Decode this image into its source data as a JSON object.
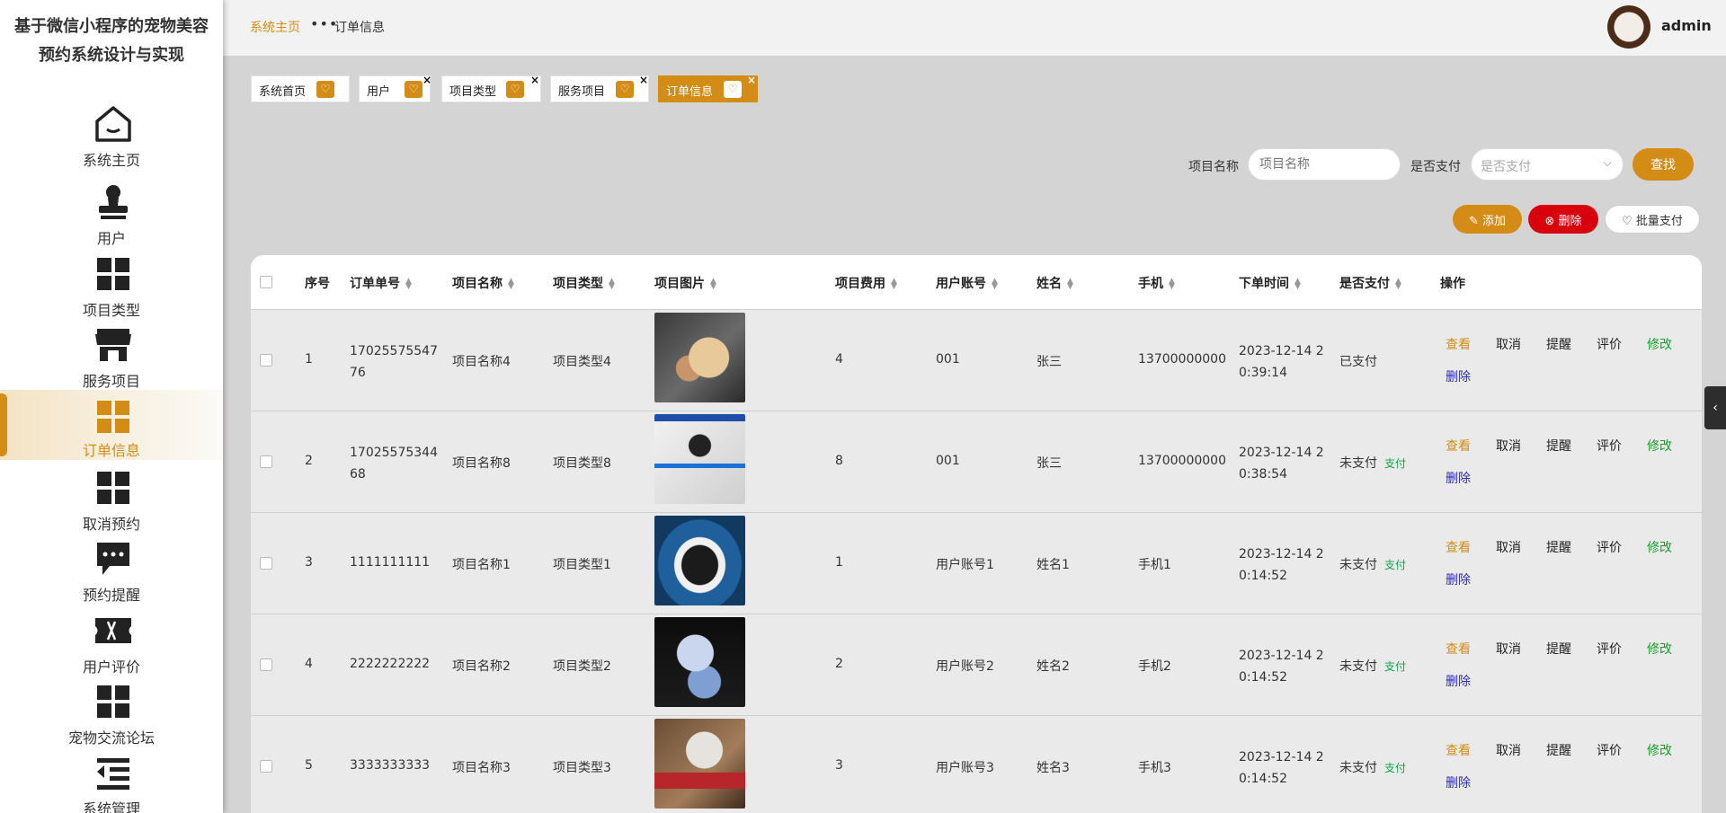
{
  "app_title": "基于微信小程序的宠物美容预约系统设计与实现",
  "sidebar": {
    "items": [
      {
        "label": "系统主页",
        "icon": "home-icon"
      },
      {
        "label": "用户",
        "icon": "user-icon"
      },
      {
        "label": "项目类型",
        "icon": "grid-icon"
      },
      {
        "label": "服务项目",
        "icon": "shop-icon"
      },
      {
        "label": "订单信息",
        "icon": "grid-icon",
        "active": true
      },
      {
        "label": "取消预约",
        "icon": "grid-icon"
      },
      {
        "label": "预约提醒",
        "icon": "chat-icon"
      },
      {
        "label": "用户评价",
        "icon": "ticket-icon"
      },
      {
        "label": "宠物交流论坛",
        "icon": "grid-icon"
      },
      {
        "label": "系统管理",
        "icon": "menu-icon"
      }
    ]
  },
  "header": {
    "breadcrumb_home": "系统主页",
    "breadcrumb_sep": "•••",
    "breadcrumb_current": "订单信息",
    "username": "admin"
  },
  "tags": [
    {
      "label": "系统首页",
      "closable": false
    },
    {
      "label": "用户",
      "closable": true
    },
    {
      "label": "项目类型",
      "closable": true
    },
    {
      "label": "服务项目",
      "closable": true
    },
    {
      "label": "订单信息",
      "closable": true,
      "active": true
    }
  ],
  "search": {
    "name_label": "项目名称",
    "name_placeholder": "项目名称",
    "pay_label": "是否支付",
    "pay_placeholder": "是否支付",
    "search_button": "查找"
  },
  "actions": {
    "add": "添加",
    "delete": "删除",
    "batch_pay": "批量支付"
  },
  "table": {
    "headers": {
      "index": "序号",
      "order_no": "订单单号",
      "item_name": "项目名称",
      "item_type": "项目类型",
      "item_image": "项目图片",
      "item_fee": "项目费用",
      "account": "用户账号",
      "name": "姓名",
      "phone": "手机",
      "order_time": "下单时间",
      "paid": "是否支付",
      "ops": "操作"
    },
    "op_labels": {
      "view": "查看",
      "cancel": "取消",
      "remind": "提醒",
      "review": "评价",
      "edit": "修改",
      "delete": "删除",
      "pay": "支付"
    },
    "rows": [
      {
        "index": "1",
        "order_no": "17025575547 76",
        "item_name": "项目名称4",
        "item_type": "项目类型4",
        "fee": "4",
        "account": "001",
        "name": "张三",
        "phone": "13700000000",
        "time": "2023-12-14 2 0:39:14",
        "paid": "已支付",
        "show_pay": false
      },
      {
        "index": "2",
        "order_no": "17025575344 68",
        "item_name": "项目名称8",
        "item_type": "项目类型8",
        "fee": "8",
        "account": "001",
        "name": "张三",
        "phone": "13700000000",
        "time": "2023-12-14 2 0:38:54",
        "paid": "未支付",
        "show_pay": true
      },
      {
        "index": "3",
        "order_no": "1111111111",
        "item_name": "项目名称1",
        "item_type": "项目类型1",
        "fee": "1",
        "account": "用户账号1",
        "name": "姓名1",
        "phone": "手机1",
        "time": "2023-12-14 2 0:14:52",
        "paid": "未支付",
        "show_pay": true
      },
      {
        "index": "4",
        "order_no": "2222222222",
        "item_name": "项目名称2",
        "item_type": "项目类型2",
        "fee": "2",
        "account": "用户账号2",
        "name": "姓名2",
        "phone": "手机2",
        "time": "2023-12-14 2 0:14:52",
        "paid": "未支付",
        "show_pay": true
      },
      {
        "index": "5",
        "order_no": "3333333333",
        "item_name": "项目名称3",
        "item_type": "项目类型3",
        "fee": "3",
        "account": "用户账号3",
        "name": "姓名3",
        "phone": "手机3",
        "time": "2023-12-14 2 0:14:52",
        "paid": "未支付",
        "show_pay": true
      }
    ]
  },
  "colors": {
    "accent": "#d38c16",
    "danger": "#d9000e",
    "edit": "#1d9a2f",
    "delete_link": "#2c2cb4",
    "pay_link": "#12a04a"
  }
}
